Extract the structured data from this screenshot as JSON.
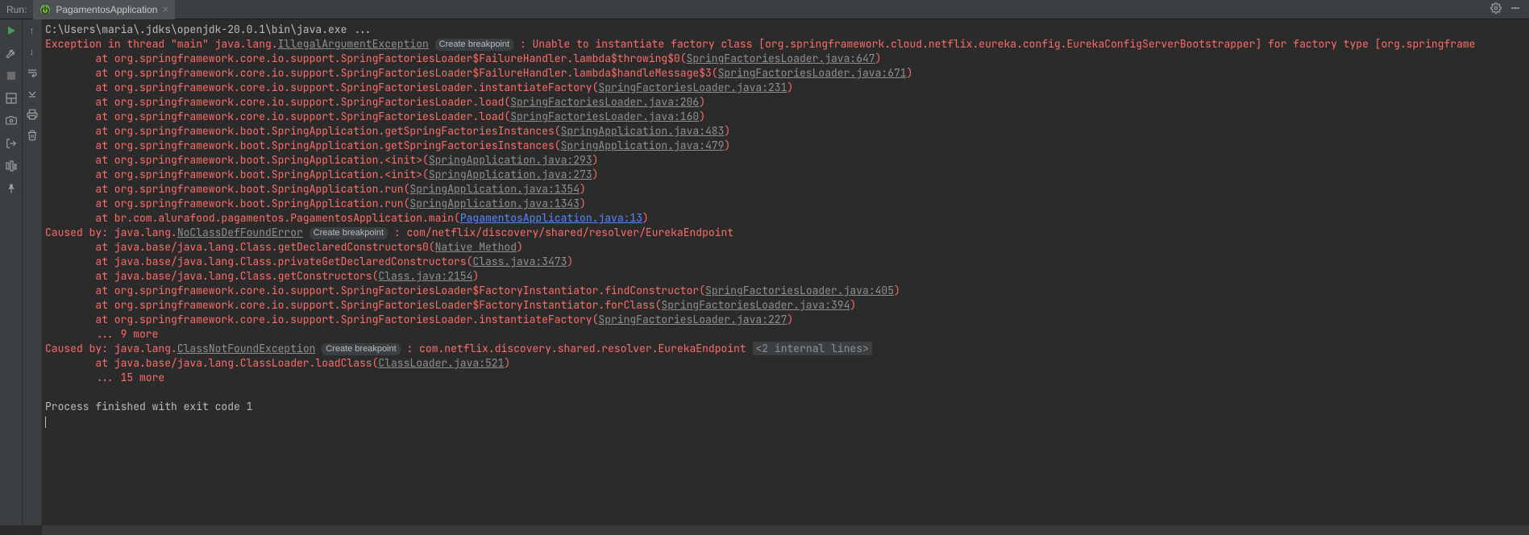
{
  "header": {
    "run_label": "Run:",
    "tab_name": "PagamentosApplication"
  },
  "cmd_line": "C:\\Users\\maria\\.jdks\\openjdk-20.0.1\\bin\\java.exe ...",
  "breakpoint_label": "Create breakpoint",
  "exc1": {
    "prefix": "Exception in thread \"main\" java.lang.",
    "type": "IllegalArgumentException",
    "msg": " : Unable to instantiate factory class [org.springframework.cloud.netflix.eureka.config.EurekaConfigServerBootstrapper] for factory type [org.springframe"
  },
  "stack1": [
    {
      "pre": "        at org.springframework.core.io.support.SpringFactoriesLoader$FailureHandler.lambda$throwing$0(",
      "link": "SpringFactoriesLoader.java:647",
      "post": ")"
    },
    {
      "pre": "        at org.springframework.core.io.support.SpringFactoriesLoader$FailureHandler.lambda$handleMessage$3(",
      "link": "SpringFactoriesLoader.java:671",
      "post": ")"
    },
    {
      "pre": "        at org.springframework.core.io.support.SpringFactoriesLoader.instantiateFactory(",
      "link": "SpringFactoriesLoader.java:231",
      "post": ")"
    },
    {
      "pre": "        at org.springframework.core.io.support.SpringFactoriesLoader.load(",
      "link": "SpringFactoriesLoader.java:206",
      "post": ")"
    },
    {
      "pre": "        at org.springframework.core.io.support.SpringFactoriesLoader.load(",
      "link": "SpringFactoriesLoader.java:160",
      "post": ")"
    },
    {
      "pre": "        at org.springframework.boot.SpringApplication.getSpringFactoriesInstances(",
      "link": "SpringApplication.java:483",
      "post": ")"
    },
    {
      "pre": "        at org.springframework.boot.SpringApplication.getSpringFactoriesInstances(",
      "link": "SpringApplication.java:479",
      "post": ")"
    },
    {
      "pre": "        at org.springframework.boot.SpringApplication.<init>(",
      "link": "SpringApplication.java:293",
      "post": ")"
    },
    {
      "pre": "        at org.springframework.boot.SpringApplication.<init>(",
      "link": "SpringApplication.java:273",
      "post": ")"
    },
    {
      "pre": "        at org.springframework.boot.SpringApplication.run(",
      "link": "SpringApplication.java:1354",
      "post": ")"
    },
    {
      "pre": "        at org.springframework.boot.SpringApplication.run(",
      "link": "SpringApplication.java:1343",
      "post": ")"
    },
    {
      "pre": "        at br.com.alurafood.pagamentos.PagamentosApplication.main(",
      "link": "PagamentosApplication.java:13",
      "post": ")",
      "blue": true
    }
  ],
  "exc2": {
    "prefix": "Caused by: java.lang.",
    "type": "NoClassDefFoundError",
    "msg": " : com/netflix/discovery/shared/resolver/EurekaEndpoint"
  },
  "stack2": [
    {
      "pre": "        at java.base/java.lang.Class.getDeclaredConstructors0(",
      "link": "Native Method",
      "post": ")"
    },
    {
      "pre": "        at java.base/java.lang.Class.privateGetDeclaredConstructors(",
      "link": "Class.java:3473",
      "post": ")"
    },
    {
      "pre": "        at java.base/java.lang.Class.getConstructors(",
      "link": "Class.java:2154",
      "post": ")"
    },
    {
      "pre": "        at org.springframework.core.io.support.SpringFactoriesLoader$FactoryInstantiator.findConstructor(",
      "link": "SpringFactoriesLoader.java:405",
      "post": ")"
    },
    {
      "pre": "        at org.springframework.core.io.support.SpringFactoriesLoader$FactoryInstantiator.forClass(",
      "link": "SpringFactoriesLoader.java:394",
      "post": ")"
    },
    {
      "pre": "        at org.springframework.core.io.support.SpringFactoriesLoader.instantiateFactory(",
      "link": "SpringFactoriesLoader.java:227",
      "post": ")"
    }
  ],
  "more1": "        ... 9 more",
  "exc3": {
    "prefix": "Caused by: java.lang.",
    "type": "ClassNotFoundException",
    "msg": " : com.netflix.discovery.shared.resolver.EurekaEndpoint ",
    "internal": "<2 internal lines>"
  },
  "stack3": [
    {
      "pre": "        at java.base/java.lang.ClassLoader.loadClass(",
      "link": "ClassLoader.java:521",
      "post": ")"
    }
  ],
  "more2": "        ... 15 more",
  "exitline": "Process finished with exit code 1"
}
